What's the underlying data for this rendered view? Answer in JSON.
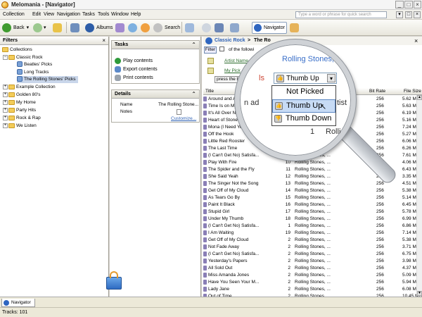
{
  "window": {
    "title": "Melomania - [Navigator]"
  },
  "menu": [
    "Collection",
    "Edit",
    "View",
    "Navigation",
    "Tasks",
    "Tools",
    "Window",
    "Help"
  ],
  "search": {
    "placeholder": "Type a word or phrase for quick search"
  },
  "toolbar": {
    "back": "Back",
    "albums": "Albums",
    "search": "Search",
    "navigator": "Navigator"
  },
  "filters": {
    "title": "Filters",
    "tree": [
      {
        "label": "Collections",
        "type": "folder",
        "level": 0
      },
      {
        "label": "Classic Rock",
        "type": "folder",
        "level": 1
      },
      {
        "label": "Beatles' Picks",
        "type": "playlist",
        "level": 2
      },
      {
        "label": "Long Tracks",
        "type": "playlist",
        "level": 2
      },
      {
        "label": "The Rolling Stones' Picks",
        "type": "playlist",
        "level": 2,
        "selected": true
      },
      {
        "label": "Example Collection",
        "type": "folder",
        "level": 0
      },
      {
        "label": "Golden 80's",
        "type": "folder",
        "level": 0
      },
      {
        "label": "My Home",
        "type": "folder",
        "level": 0
      },
      {
        "label": "Party Hits",
        "type": "folder",
        "level": 0
      },
      {
        "label": "Rock & Rap",
        "type": "folder",
        "level": 0
      },
      {
        "label": "We Listen",
        "type": "folder",
        "level": 0
      }
    ]
  },
  "tasks": {
    "title": "Tasks",
    "items": [
      "Play contents",
      "Export contents",
      "Print contents"
    ]
  },
  "details": {
    "title": "Details",
    "rows": [
      {
        "key": "Name",
        "value": "The Rolling Stone..."
      },
      {
        "key": "Notes",
        "value": ""
      }
    ],
    "customize": "Customize..."
  },
  "navigator": {
    "crumb_root": "Classic Rock",
    "crumb_current": "The Ro",
    "filter_button": "Filter",
    "filter_text": "of the followi",
    "artist_link": "Artist Name",
    "mypick_link": "My Pick",
    "press_button": "press the butt",
    "columns": {
      "title": "Title",
      "bitrate": "Bit Rate",
      "filesize": "File Size"
    },
    "tracks": [
      {
        "title": "Around and Around",
        "no": "",
        "artist": "",
        "bitrate": "256",
        "size": "5.62 MB"
      },
      {
        "title": "Time Is on My Side",
        "no": "",
        "artist": "",
        "bitrate": "256",
        "size": "5.63 MB"
      },
      {
        "title": "It's All Over Now",
        "no": "",
        "artist": "",
        "bitrate": "256",
        "size": "6.19 MB"
      },
      {
        "title": "Heart of Stone",
        "no": "",
        "artist": "",
        "bitrate": "256",
        "size": "5.16 MB"
      },
      {
        "title": "Mona (I Need You Baby)",
        "no": "",
        "artist": "",
        "bitrate": "256",
        "size": "7.24 MB"
      },
      {
        "title": "Off the Hook",
        "no": "",
        "artist": "",
        "bitrate": "256",
        "size": "5.27 MB"
      },
      {
        "title": "Little Red Rooster",
        "no": "",
        "artist": "",
        "bitrate": "256",
        "size": "6.06 MB"
      },
      {
        "title": "The Last Time",
        "no": "8",
        "artist": "Rolling Stones, ...",
        "bitrate": "256",
        "size": "6.26 MB"
      },
      {
        "title": "(I Can't Get No) Satisfa...",
        "no": "9",
        "artist": "Rolling Stones, ...",
        "bitrate": "256",
        "size": "7.61 MB"
      },
      {
        "title": "Play With Fire",
        "no": "10",
        "artist": "Rolling Stones, ...",
        "bitrate": "256",
        "size": "4.06 MB"
      },
      {
        "title": "The Spider and the Fly",
        "no": "11",
        "artist": "Rolling Stones, ...",
        "bitrate": "256",
        "size": "6.43 MB"
      },
      {
        "title": "She Said Yeah",
        "no": "12",
        "artist": "Rolling Stones, ...",
        "bitrate": "256",
        "size": "3.35 MB"
      },
      {
        "title": "The Singer Not the Song",
        "no": "13",
        "artist": "Rolling Stones, ...",
        "bitrate": "256",
        "size": "4.51 MB"
      },
      {
        "title": "Get Off of My Cloud",
        "no": "14",
        "artist": "Rolling Stones, ...",
        "bitrate": "256",
        "size": "5.38 MB"
      },
      {
        "title": "As Tears Go By",
        "no": "15",
        "artist": "Rolling Stones, ...",
        "bitrate": "256",
        "size": "5.14 MB"
      },
      {
        "title": "Paint It Black",
        "no": "16",
        "artist": "Rolling Stones, ...",
        "bitrate": "256",
        "size": "6.45 MB"
      },
      {
        "title": "Stupid Girl",
        "no": "17",
        "artist": "Rolling Stones, ...",
        "bitrate": "256",
        "size": "5.78 MB"
      },
      {
        "title": "Under My Thumb",
        "no": "18",
        "artist": "Rolling Stones, ...",
        "bitrate": "256",
        "size": "6.99 MB"
      },
      {
        "title": "(I Can't Get No) Satisfa...",
        "no": "1",
        "artist": "Rolling Stones, ...",
        "bitrate": "256",
        "size": "6.86 MB"
      },
      {
        "title": "I Am Waiting",
        "no": "19",
        "artist": "Rolling Stones, ...",
        "bitrate": "256",
        "size": "7.14 MB"
      },
      {
        "title": "Get Off of My Cloud",
        "no": "2",
        "artist": "Rolling Stones, ...",
        "bitrate": "256",
        "size": "5.38 MB"
      },
      {
        "title": "Not Fade Away",
        "no": "2",
        "artist": "Rolling Stones, ...",
        "bitrate": "256",
        "size": "3.71 MB"
      },
      {
        "title": "(I Can't Get No) Satisfa...",
        "no": "2",
        "artist": "Rolling Stones, ...",
        "bitrate": "256",
        "size": "6.75 MB"
      },
      {
        "title": "Yesterday's Papers",
        "no": "2",
        "artist": "Rolling Stones, ...",
        "bitrate": "256",
        "size": "3.98 MB"
      },
      {
        "title": "All Sold Out",
        "no": "2",
        "artist": "Rolling Stones, ...",
        "bitrate": "256",
        "size": "4.37 MB"
      },
      {
        "title": "Miss Amanda Jones",
        "no": "2",
        "artist": "Rolling Stones, ...",
        "bitrate": "256",
        "size": "5.09 MB"
      },
      {
        "title": "Have You Seen Your M...",
        "no": "2",
        "artist": "Rolling Stones, ...",
        "bitrate": "256",
        "size": "5.94 MB"
      },
      {
        "title": "Lady Jane",
        "no": "2",
        "artist": "Rolling Stones, ...",
        "bitrate": "256",
        "size": "6.08 MB"
      },
      {
        "title": "Out of Time",
        "no": "2",
        "artist": "Rolling Stones, ...",
        "bitrate": "256",
        "size": "10.45 MB"
      }
    ]
  },
  "magnifier": {
    "combo_value": "Thumb Up",
    "header_fragment": "Rolling Stones,",
    "left_fragment": "ls",
    "row_fragment_a": "n ad",
    "row_fragment_b": "tist",
    "row_fragment_c": "1",
    "row_fragment_d": "Rolli",
    "options": [
      "Not Picked",
      "Thumb Up",
      "Thumb Down"
    ],
    "highlighted": "Thumb Up"
  },
  "bottom_tab": "Navigator",
  "status": "Tracks: 101",
  "colors": {
    "accent": "#2b5fb4",
    "link": "#2a6a2a",
    "selection": "#c7dbf5"
  }
}
